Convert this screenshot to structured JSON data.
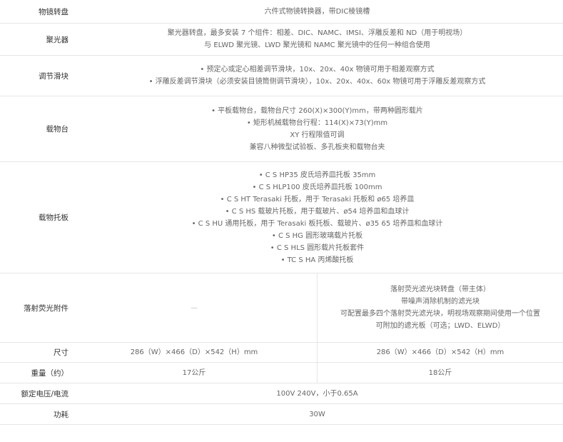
{
  "rows": [
    {
      "label": "物镜转盘",
      "lines": [
        "六件式物镜转换器，带DIC棱镜槽"
      ]
    },
    {
      "label": "聚光器",
      "lines": [
        "聚光器转盘，最多安装 7 个组件：相差、DIC、NAMC、IMSI、浮雕反差和 ND（用于明视场）",
        "与 ELWD 聚光镜、LWD 聚光镜和 NAMC 聚光镜中的任何一种组合使用"
      ]
    },
    {
      "label": "调节滑块",
      "lines": [
        "• 预定心或定心相差调节滑块，10x、20x、40x 物镜可用于相差观察方式",
        "• 浮雕反差调节滑块（必须安装目镜筒侧调节滑块），10x、20x、40x、60x 物镜可用于浮雕反差观察方式"
      ]
    },
    {
      "label": "载物台",
      "lines": [
        "• 平板载物台，载物台尺寸 260(X)×300(Y)mm，带两种圆形载片",
        "• 矩形机械载物台行程：114(X)×73(Y)mm",
        "XY 行程限值可调",
        "兼容八种微型试验板、多孔板夹和载物台夹"
      ]
    },
    {
      "label": "载物托板",
      "lines": [
        "• C S HP35 皮氏培养皿托板 35mm",
        "• C S HLP100 皮氏培养皿托板 100mm",
        "• C S HT Terasaki 托板，用于 Terasaki 托板和 ø65 培养皿",
        "• C S HS 载玻片托板，用于载玻片、ø54 培养皿和血球计",
        "• C S HU 通用托板，用于 Terasaki 板托板、载玻片、ø35 65 培养皿和血球计",
        "• C S HG 圆形玻璃载片托板",
        "• C S HLS 圆形载片托板套件",
        "• TC S HA 丙烯酸托板"
      ]
    },
    {
      "label": "落射荧光附件",
      "left": [
        "—"
      ],
      "right": [
        "落射荧光滤光块转盘（带主体）",
        "带噪声消除机制的滤光块",
        "可配置最多四个落射荧光滤光块，明视场观察期间使用一个位置",
        "可附加的遮光板（可选；LWD、ELWD）"
      ]
    },
    {
      "label": "尺寸",
      "left": [
        "286（W）×466（D）×542（H）mm"
      ],
      "right": [
        "286（W）×466（D）×542（H）mm"
      ]
    },
    {
      "label": "重量（约）",
      "left": [
        "17公斤"
      ],
      "right": [
        "18公斤"
      ]
    },
    {
      "label": "额定电压/电流",
      "lines": [
        "100V 240V，小于0.65A"
      ]
    },
    {
      "label": "功耗",
      "lines": [
        "30W"
      ]
    }
  ]
}
